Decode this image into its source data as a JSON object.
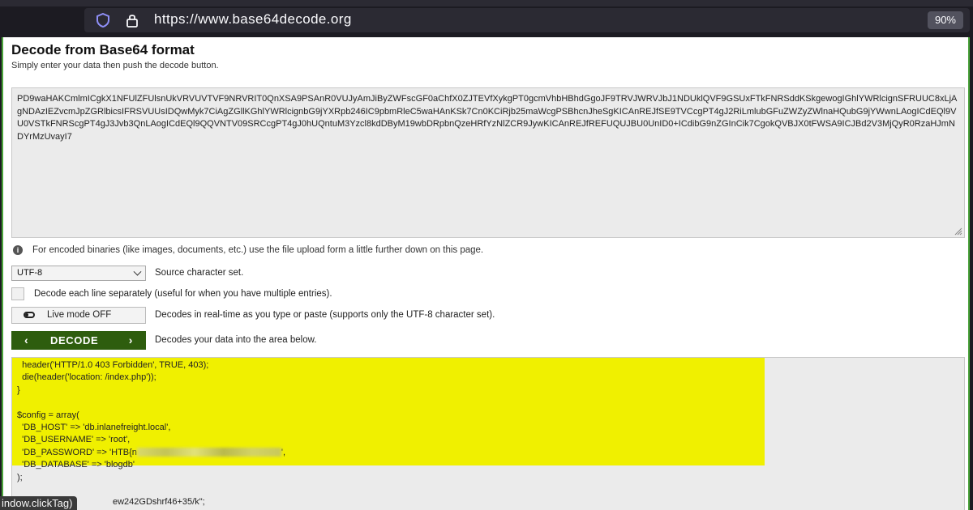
{
  "browser": {
    "url": "https://www.base64decode.org",
    "zoom": "90%"
  },
  "page": {
    "title": "Decode from Base64 format",
    "subtitle": "Simply enter your data then push the decode button.",
    "input_value": "PD9waHAKCmlmICgkX1NFUlZFUlsnUkVRVUVTVF9NRVRIT0QnXSA9PSAnR0VUJyAmJiByZWFscGF0aChfX0ZJTEVfXykgPT0gcmVhbHBhdGgoJF9TRVJWRVJbJ1NDUklQVF9GSUxFTkFNRSddKSkgewogIGhlYWRlcignSFRUUC8xLjAgNDAzIEZvcmJpZGRlbicsIFRSVUUsIDQwMyk7CiAgZGllKGhlYWRlcignbG9jYXRpb246IC9pbmRleC5waHAnKSk7Cn0KCiRjb25maWcgPSBhcnJheSgKICAnREJfSE9TVCcgPT4gJ2RiLmlubGFuZWZyZWlnaHQubG9jYWwnLAogICdEQl9VU0VSTkFNRScgPT4gJ3Jvb3QnLAogICdEQl9QQVNTV09SRCcgPT4gJ0hUQntuM3Yzcl8kdDByM19wbDRpbnQzeHRfYzNlZCR9JywKICAnREJfREFUQUJBU0UnID0+ICdibG9nZGInCik7CgokQVBJX0tFWSA9ICJBd2V3MjQyR0RzaHJmNDYrMzUvayI7",
    "info_text": "For encoded binaries (like images, documents, etc.) use the file upload form a little further down on this page.",
    "charset_value": "UTF-8",
    "charset_label": "Source character set.",
    "each_line_label": "Decode each line separately (useful for when you have multiple entries).",
    "live_mode_label": "Live mode OFF",
    "live_mode_desc": "Decodes in real-time as you type or paste (supports only the UTF-8 character set).",
    "decode_label": "DECODE",
    "decode_desc": "Decodes your data into the area below.",
    "output_lines": [
      "  header('HTTP/1.0 403 Forbidden', TRUE, 403);",
      "  die(header('location: /index.php'));",
      "}",
      "",
      "$config = array(",
      "  'DB_HOST' => 'db.inlanefreight.local',",
      "  'DB_USERNAME' => 'root',",
      "  'DB_PASSWORD' => 'HTB{n",
      "',",
      "  'DB_DATABASE' => 'blogdb'",
      ");",
      "",
      "ew242GDshrf46+35/k\";"
    ],
    "tooltip": "indow.clickTag)"
  },
  "colors": {
    "highlight": "#f0f000",
    "decode_button": "#2e5d0e",
    "border_accent": "#4aa33a"
  }
}
